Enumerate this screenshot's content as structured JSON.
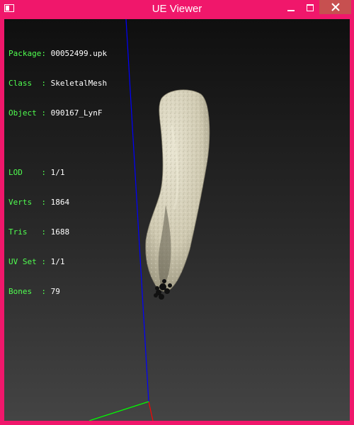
{
  "window": {
    "title": "UE Viewer",
    "accent_color": "#f0176b",
    "close_hover_color": "#c75050"
  },
  "info": {
    "package_label": "Package:",
    "package_value": "00052499.upk",
    "class_label": "Class  :",
    "class_value": "SkeletalMesh",
    "object_label": "Object :",
    "object_value": "090167_LynF",
    "lod_label": "LOD    :",
    "lod_value": "1/1",
    "verts_label": "Verts  :",
    "verts_value": "1864",
    "tris_label": "Tris   :",
    "tris_value": "1688",
    "uvset_label": "UV Set :",
    "uvset_value": "1/1",
    "bones_label": "Bones  :",
    "bones_value": "79"
  },
  "icons": {
    "app": "window-app-icon",
    "minimize": "minimize-icon",
    "maximize": "maximize-icon",
    "close": "close-icon"
  },
  "colors": {
    "label": "#50ff50",
    "value": "#ffffff",
    "axis_y": "#0000ff",
    "axis_x": "#ff0000",
    "axis_z": "#00ff00",
    "mesh": "#d8d3bf"
  }
}
